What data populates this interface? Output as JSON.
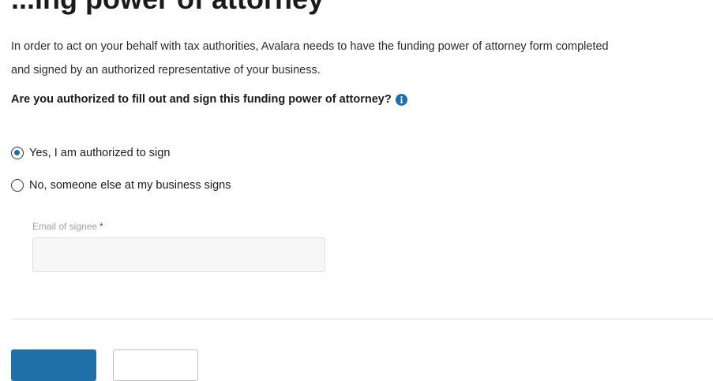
{
  "page": {
    "title": "...ing power of attorney"
  },
  "intro": {
    "text": "In order to act on your behalf with tax authorities, Avalara needs to have the funding power of attorney form completed and signed by an authorized representative of your business."
  },
  "question": {
    "label": "Are you authorized to fill out and sign this funding power of attorney?",
    "info_icon": "info-circle-icon"
  },
  "options": [
    {
      "label": "Yes, I am authorized to sign",
      "selected": true
    },
    {
      "label": "No, someone else at my business signs",
      "selected": false
    }
  ],
  "email": {
    "label": "Email of signee",
    "required_marker": "*",
    "value": "",
    "placeholder": ""
  },
  "buttons": {
    "primary_label": "",
    "secondary_label": ""
  },
  "colors": {
    "accent": "#1f6fa8",
    "required": "#c4262e",
    "info_icon": "#1a6fb0"
  }
}
